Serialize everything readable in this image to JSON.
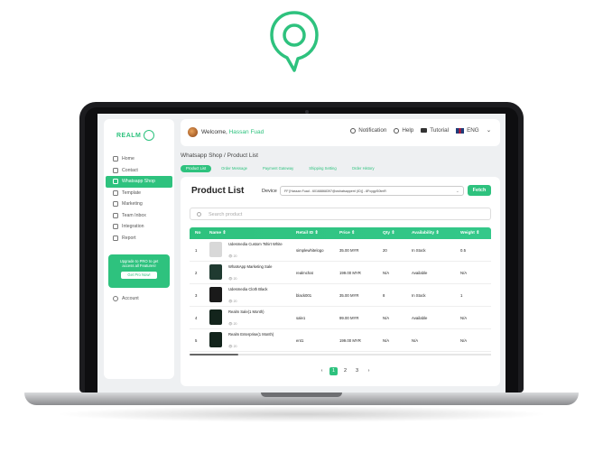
{
  "colors": {
    "accent": "#2ec27e",
    "lid": "#1c1c1f"
  },
  "sidebar": {
    "brand": "REALM",
    "items": [
      {
        "label": "Home",
        "icon": "home-icon"
      },
      {
        "label": "Contact",
        "icon": "contact-icon"
      },
      {
        "label": "Whatsapp Shop",
        "icon": "shop-icon",
        "active": true
      },
      {
        "label": "Template",
        "icon": "template-icon"
      },
      {
        "label": "Marketing",
        "icon": "marketing-icon"
      },
      {
        "label": "Team Inbox",
        "icon": "inbox-icon"
      },
      {
        "label": "Integration",
        "icon": "integration-icon"
      },
      {
        "label": "Report",
        "icon": "report-icon"
      }
    ],
    "upgrade_text": "Upgrade to PRO to get access all Features!",
    "upgrade_button": "Get Pro Now!",
    "account": "Account"
  },
  "header": {
    "welcome": "Welcome,",
    "user": "Hassan Fuad",
    "notification": "Notification",
    "help": "Help",
    "tutorial": "Tutorial",
    "language": "ENG"
  },
  "breadcrumb": "Whatsapp Shop / Product List",
  "tabs": [
    "Product List",
    "Order Message",
    "Payment Gateway",
    "Shipping Setting",
    "Order History"
  ],
  "main": {
    "title": "Product List",
    "device_label": "Device",
    "device_value": "FF [Hassan Fuad - 60168868397@cwhatsapperrl (ID)] - 8FcygpS0tmR",
    "fetch": "Fetch",
    "search_placeholder": "Search product"
  },
  "table": {
    "headers": [
      "No",
      "Name",
      "Retail ID",
      "Price",
      "Qty",
      "Availability",
      "Weight"
    ],
    "rows": [
      {
        "no": "1",
        "name": "Udesmedia Custom Tshirt White",
        "views": "20",
        "retail_id": "simplewhitelogo",
        "price": "35.00 MYR",
        "qty": "20",
        "availability": "In Stock",
        "weight": "0.5",
        "img": "#d8d8d8"
      },
      {
        "no": "2",
        "name": "WhatsApp Marketing Sale",
        "views": "20",
        "retail_id": "realmchat",
        "price": "199.00 MYR",
        "qty": "N/A",
        "availability": "Available",
        "weight": "N/A",
        "img": "#1f3a30"
      },
      {
        "no": "3",
        "name": "Udesmedia Cloth Black",
        "views": "20",
        "retail_id": "black001",
        "price": "35.00 MYR",
        "qty": "8",
        "availability": "In Stock",
        "weight": "1",
        "img": "#1a1a1a"
      },
      {
        "no": "4",
        "name": "Realm Sale(1 Month)",
        "views": "20",
        "retail_id": "sale1",
        "price": "99.00 MYR",
        "qty": "N/A",
        "availability": "Available",
        "weight": "N/A",
        "img": "#13241c"
      },
      {
        "no": "5",
        "name": "Realm Enterprise(1 Month)",
        "views": "20",
        "retail_id": "ent1",
        "price": "199.00 MYR",
        "qty": "N/A",
        "availability": "N/A",
        "weight": "N/A",
        "img": "#13241c"
      }
    ]
  },
  "pagination": {
    "prev": "‹",
    "pages": [
      "1",
      "2",
      "3"
    ],
    "next": "›",
    "current": "1"
  }
}
